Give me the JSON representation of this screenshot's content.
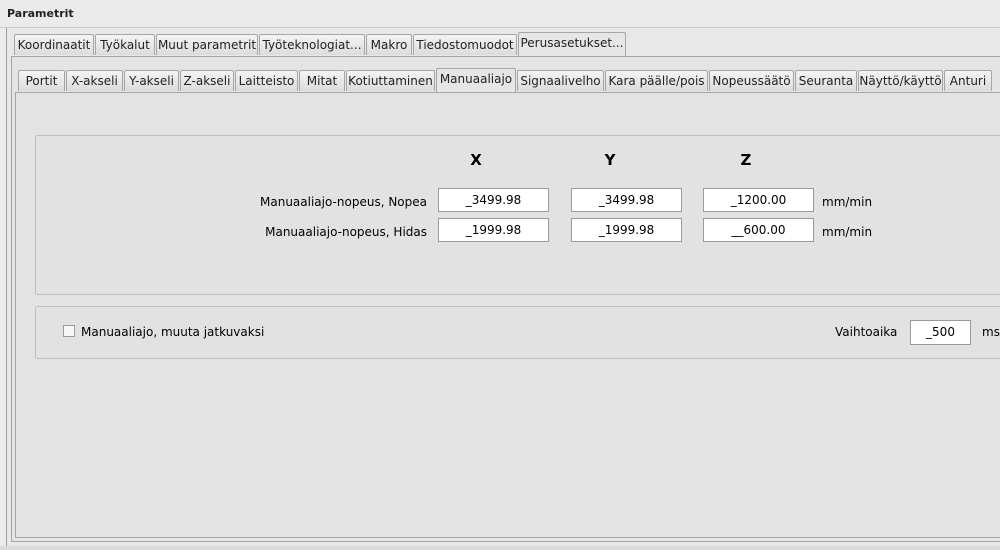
{
  "window": {
    "title": "Parametrit"
  },
  "main_tabs": [
    {
      "label": "Koordinaatit",
      "active": false
    },
    {
      "label": "Työkalut",
      "active": false
    },
    {
      "label": "Muut parametrit",
      "active": false
    },
    {
      "label": "Työteknologiat...",
      "active": false
    },
    {
      "label": "Makro",
      "active": false
    },
    {
      "label": "Tiedostomuodot",
      "active": false
    },
    {
      "label": "Perusasetukset...",
      "active": true
    }
  ],
  "sub_tabs": [
    {
      "label": "Portit",
      "active": false
    },
    {
      "label": "X-akseli",
      "active": false
    },
    {
      "label": "Y-akseli",
      "active": false
    },
    {
      "label": "Z-akseli",
      "active": false
    },
    {
      "label": "Laitteisto",
      "active": false
    },
    {
      "label": "Mitat",
      "active": false
    },
    {
      "label": "Kotiuttaminen",
      "active": false
    },
    {
      "label": "Manuaaliajo",
      "active": true
    },
    {
      "label": "Signaalivelho",
      "active": false
    },
    {
      "label": "Kara päälle/pois",
      "active": false
    },
    {
      "label": "Nopeussäätö",
      "active": false
    },
    {
      "label": "Seuranta",
      "active": false
    },
    {
      "label": "Näyttö/käyttö",
      "active": false
    },
    {
      "label": "Anturi",
      "active": false
    }
  ],
  "speeds": {
    "columns": [
      "X",
      "Y",
      "Z"
    ],
    "rows": [
      {
        "label": "Manuaaliajo-nopeus, Nopea",
        "values": [
          "_3499.98",
          "_3499.98",
          "_1200.00"
        ],
        "unit": "mm/min"
      },
      {
        "label": "Manuaaliajo-nopeus, Hidas",
        "values": [
          "_1999.98",
          "_1999.98",
          "__600.00"
        ],
        "unit": "mm/min"
      }
    ]
  },
  "continuous": {
    "checkbox_label": "Manuaaliajo, muuta jatkuvaksi",
    "checked": false,
    "switch_label": "Vaihtoaika",
    "switch_value": "_500",
    "switch_unit": "ms"
  }
}
